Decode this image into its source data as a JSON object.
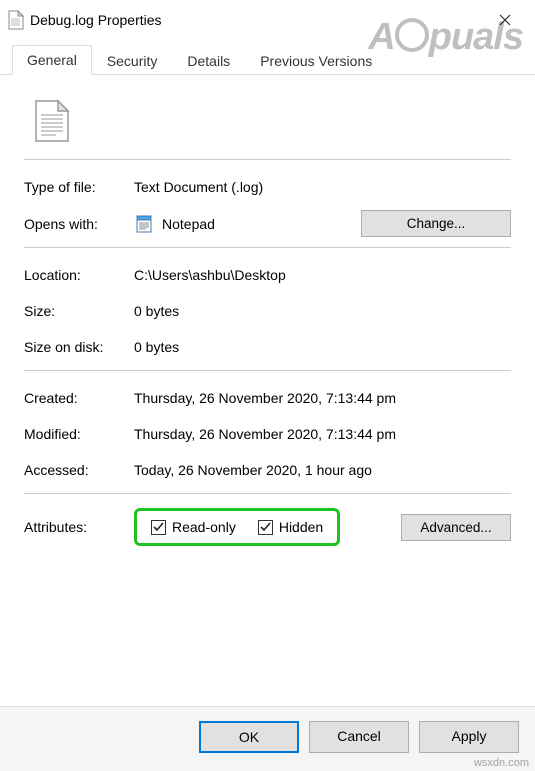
{
  "window": {
    "title": "Debug.log Properties",
    "watermark_text": "A     puals"
  },
  "tabs": {
    "general": "General",
    "security": "Security",
    "details": "Details",
    "previous": "Previous Versions"
  },
  "labels": {
    "type_of_file": "Type of file:",
    "opens_with": "Opens with:",
    "location": "Location:",
    "size": "Size:",
    "size_on_disk": "Size on disk:",
    "created": "Created:",
    "modified": "Modified:",
    "accessed": "Accessed:",
    "attributes": "Attributes:"
  },
  "values": {
    "type_of_file": "Text Document (.log)",
    "opens_with_app": "Notepad",
    "location": "C:\\Users\\ashbu\\Desktop",
    "size": "0 bytes",
    "size_on_disk": "0 bytes",
    "created": "Thursday, 26 November 2020, 7:13:44 pm",
    "modified": "Thursday, 26 November 2020, 7:13:44 pm",
    "accessed": "Today, 26 November 2020, 1 hour ago"
  },
  "attributes": {
    "read_only_label": "Read-only",
    "read_only_checked": true,
    "hidden_label": "Hidden",
    "hidden_checked": true
  },
  "buttons": {
    "change": "Change...",
    "advanced": "Advanced...",
    "ok": "OK",
    "cancel": "Cancel",
    "apply": "Apply"
  },
  "footer_watermark": "wsxdn.com"
}
